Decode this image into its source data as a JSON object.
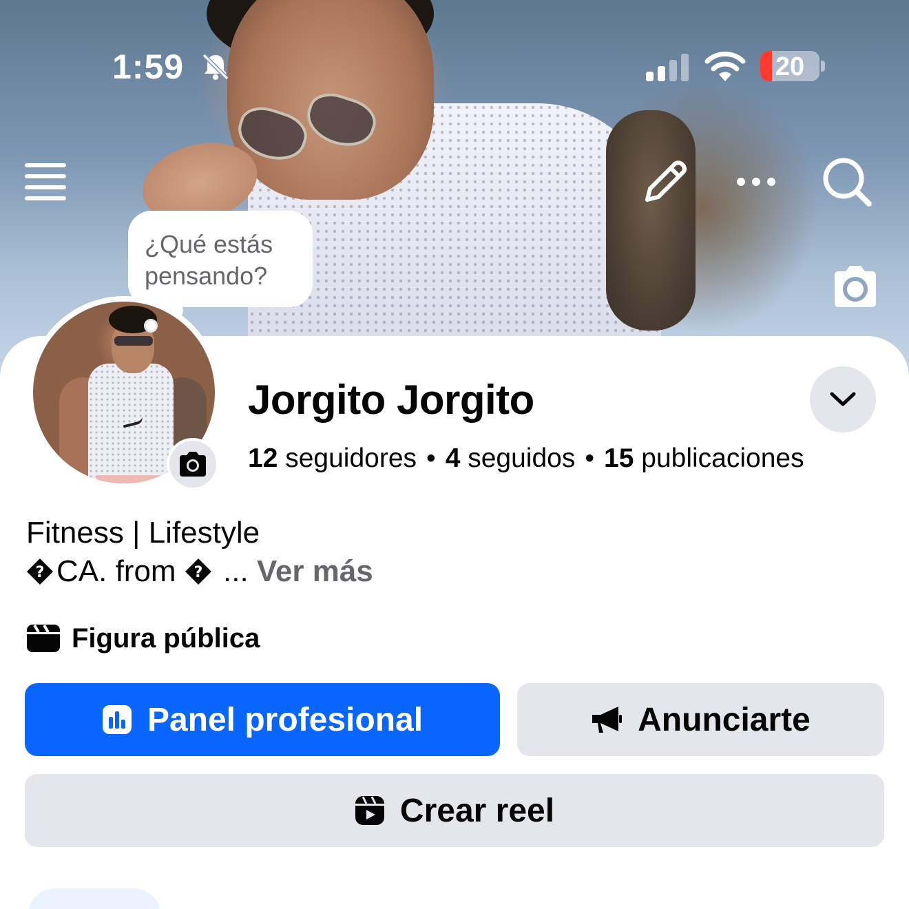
{
  "status_bar": {
    "time": "1:59",
    "battery_percent": "20",
    "battery_level": 0.2,
    "icons": [
      "bell-slash-icon",
      "cellular-signal-icon",
      "wifi-icon",
      "battery-icon"
    ]
  },
  "cover": {
    "composer_prompt": "¿Qué estás pensando?",
    "icons": [
      "menu-icon",
      "pencil-icon",
      "more-icon",
      "search-icon",
      "camera-icon"
    ]
  },
  "profile": {
    "name": "Jorgito Jorgito",
    "stats": {
      "followers_count": "12",
      "followers_label": "seguidores",
      "following_count": "4",
      "following_label": "seguidos",
      "posts_count": "15",
      "posts_label": "publicaciones",
      "separator": "•"
    },
    "bio_line1": "Fitness | Lifestyle",
    "bio_line2": "CA. from",
    "bio_ellipsis": "...",
    "see_more": "Ver más",
    "category": "Figura pública"
  },
  "actions": {
    "professional_dashboard": "Panel profesional",
    "advertise": "Anunciarte",
    "create_reel": "Crear reel"
  },
  "colors": {
    "primary": "#0866ff",
    "secondary_button": "#e4e6eb",
    "text": "#050505",
    "muted_text": "#65676b",
    "battery_low": "#ff3b30"
  }
}
